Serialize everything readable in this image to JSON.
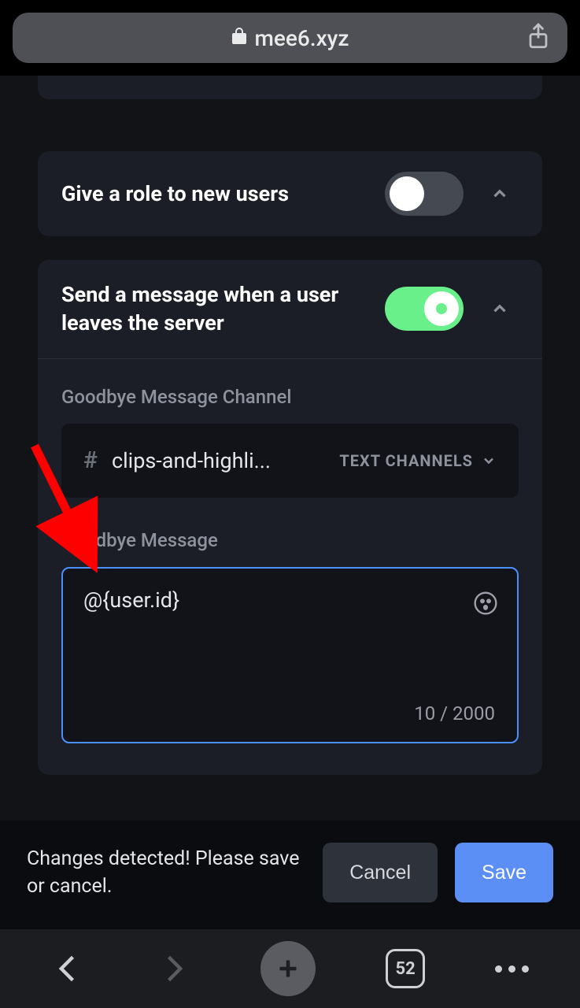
{
  "browser": {
    "url_host": "mee6.xyz",
    "tab_count": "52"
  },
  "sections": {
    "give_role": {
      "title": "Give a role to new users",
      "enabled": false
    },
    "goodbye": {
      "title": "Send a message when a user leaves the server",
      "enabled": true,
      "channel_label": "Goodbye Message Channel",
      "channel_name": "clips-and-highli...",
      "channel_group": "TEXT CHANNELS",
      "message_label": "Goodbye Message",
      "message_value": "@{user.id}",
      "counter": "10 / 2000"
    }
  },
  "savebar": {
    "message": "Changes detected! Please save or cancel.",
    "cancel": "Cancel",
    "save": "Save"
  }
}
